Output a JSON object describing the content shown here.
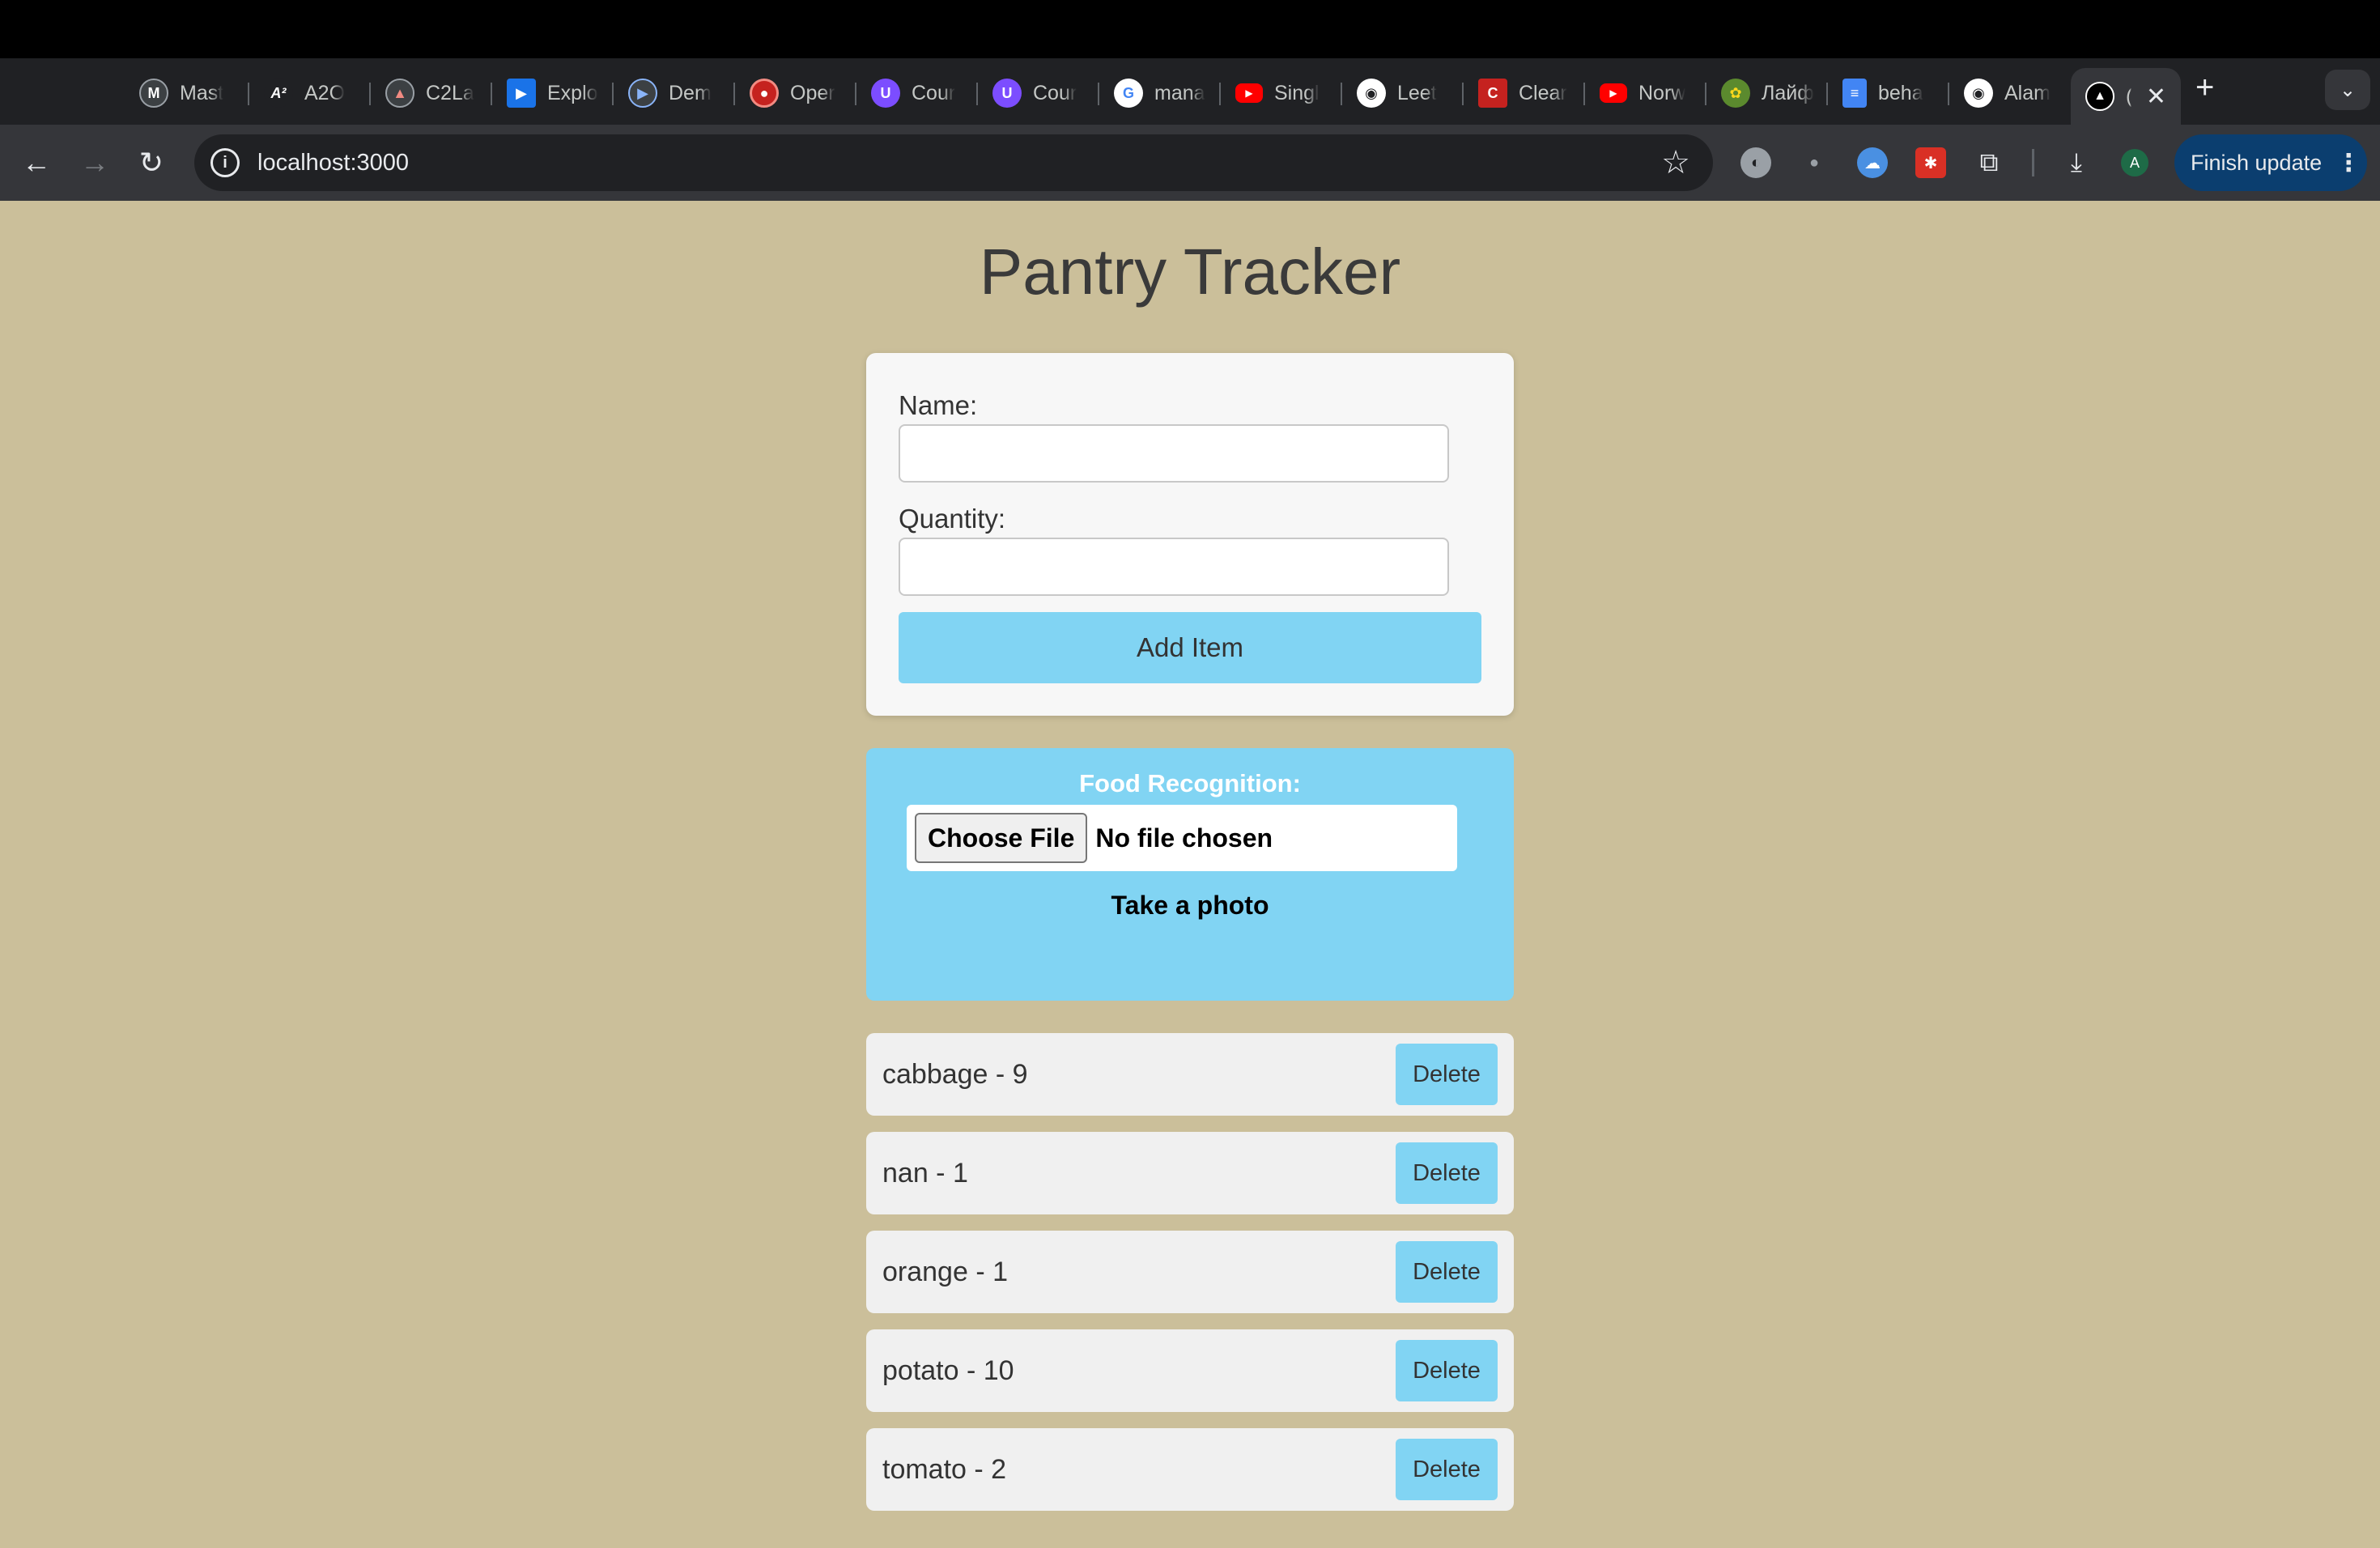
{
  "browser": {
    "tabs": [
      {
        "label": "Mast",
        "icon": "scale-logo-icon",
        "color": "#3c4043"
      },
      {
        "label": "A2O",
        "icon": "a-squared-icon",
        "color": "#202124"
      },
      {
        "label": "C2La",
        "icon": "chart-logo-icon",
        "color": "#3c4043"
      },
      {
        "label": "Explo",
        "icon": "video-play-icon",
        "color": "#1a73e8"
      },
      {
        "label": "Dem",
        "icon": "video-circle-icon",
        "color": "#3c4043"
      },
      {
        "label": "Oper",
        "icon": "record-icon",
        "color": "#c5221f"
      },
      {
        "label": "Cour",
        "icon": "course-shield-icon",
        "color": "#7c4dff"
      },
      {
        "label": "Cour",
        "icon": "course-shield-icon",
        "color": "#7c4dff"
      },
      {
        "label": "mana",
        "icon": "google-icon",
        "color": "#ffffff"
      },
      {
        "label": "Singl",
        "icon": "youtube-icon",
        "color": "#ff0000"
      },
      {
        "label": "Leet",
        "icon": "github-icon",
        "color": "#ffffff"
      },
      {
        "label": "Clear",
        "icon": "clear-logo-icon",
        "color": "#c5221f"
      },
      {
        "label": "Norw",
        "icon": "youtube-icon",
        "color": "#ff0000"
      },
      {
        "label": "Лайф",
        "icon": "flower-icon",
        "color": "#5b8a2e"
      },
      {
        "label": "beha",
        "icon": "docs-icon",
        "color": "#4285f4"
      },
      {
        "label": "Alam",
        "icon": "github-icon",
        "color": "#ffffff"
      }
    ],
    "active_tab": {
      "label": "(",
      "icon": "nextjs-icon"
    },
    "url": "localhost:3000",
    "finish_update_label": "Finish update",
    "profile_initial": "A"
  },
  "page": {
    "title": "Pantry Tracker",
    "form": {
      "name_label": "Name:",
      "name_value": "",
      "quantity_label": "Quantity:",
      "quantity_value": "",
      "add_button_label": "Add Item"
    },
    "food_recognition": {
      "label": "Food Recognition:",
      "choose_file_label": "Choose File",
      "file_status": "No file chosen",
      "take_photo_label": "Take a photo"
    },
    "items": [
      {
        "text": "cabbage - 9",
        "delete_label": "Delete"
      },
      {
        "text": "nan - 1",
        "delete_label": "Delete"
      },
      {
        "text": "orange - 1",
        "delete_label": "Delete"
      },
      {
        "text": "potato - 10",
        "delete_label": "Delete"
      },
      {
        "text": "tomato - 2",
        "delete_label": "Delete"
      }
    ],
    "accent_color": "#81d4f3",
    "background_color": "#cbbf9a"
  }
}
